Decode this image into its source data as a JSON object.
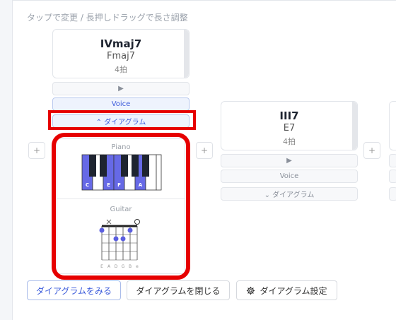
{
  "hint": "タップで変更 / 長押しドラッグで長さ調整",
  "cards": [
    {
      "roman": "IVmaj7",
      "chord": "Fmaj7",
      "beats": "4拍",
      "play_icon": "▶",
      "voice": "Voice",
      "diagram_toggle": "⌃ ダイアグラム"
    },
    {
      "roman": "III7",
      "chord": "E7",
      "beats": "4拍",
      "play_icon": "▶",
      "voice": "Voice",
      "diagram_toggle": "⌄ ダイアグラム"
    }
  ],
  "add_label": "+",
  "diagram": {
    "piano_label": "Piano",
    "guitar_label": "Guitar",
    "piano_notes": [
      "C",
      "E",
      "F",
      "A"
    ],
    "guitar_strings": [
      "E",
      "A",
      "D",
      "G",
      "B",
      "e"
    ],
    "colors": {
      "accent": "#5b5fe0",
      "highlight": "#e60000"
    }
  },
  "buttons": {
    "show": "ダイアグラムをみる",
    "close": "ダイアグラムを閉じる",
    "settings": "ダイアグラム設定"
  }
}
